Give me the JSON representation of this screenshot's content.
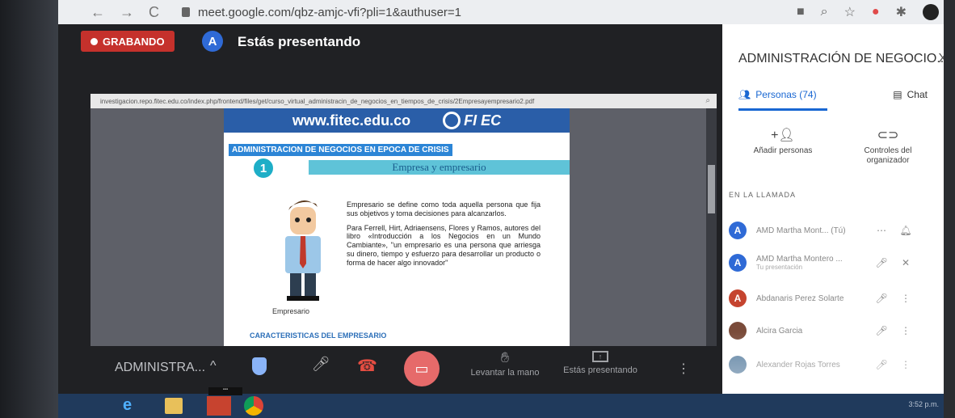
{
  "browser": {
    "url": "meet.google.com/qbz-amjc-vfi?pli=1&authuser=1",
    "nav_back": "←",
    "nav_forward": "→",
    "nav_reload": "C"
  },
  "meet": {
    "recording_label": "GRABANDO",
    "presenter_avatar": "A",
    "presenting_text": "Estás presentando"
  },
  "pdf": {
    "url": "investigacion.repo.fitec.edu.co/index.php/frontend/files/get/curso_virtual_administracin_de_negocios_en_tiempos_de_crisis/2Empresayempresario2.pdf",
    "site": "www.fitec.edu.co",
    "logo": "FI EC",
    "title": "ADMINISTRACION DE NEGOCIOS EN EPOCA DE CRISIS",
    "number": "1",
    "subtitle": "Empresa y empresario",
    "para1": "Empresario se define como toda aquella persona que fija sus objetivos y toma decisiones para alcanzarlos.",
    "para2": "Para Ferrell, Hirt, Adriaensens, Flores y Ramos, autores del libro «Introducción a los Negocios en un Mundo Cambiante», \"un empresario es una persona que arriesga su dinero, tiempo y esfuerzo para desarrollar un producto o forma de hacer algo innovador\"",
    "figure_label": "Empresario",
    "section": "CARACTERISTICAS DEL EMPRESARIO"
  },
  "controls": {
    "meeting_name": "ADMINISTRA...",
    "raise_hand": "Levantar la mano",
    "presenting": "Estás presentando"
  },
  "panel": {
    "title": "ADMINISTRACIÓN DE NEGOCIO...",
    "close": "X",
    "tab_people": "Personas (74)",
    "tab_chat": "Chat",
    "add_people": "Añadir personas",
    "host_controls": "Controles del organizador",
    "section_label": "EN LA LLAMADA",
    "participants": [
      {
        "avatar": "A",
        "name": "AMD Martha Mont... (Tú)",
        "sub": "",
        "color": "#2f6ad6"
      },
      {
        "avatar": "A",
        "name": "AMD Martha Montero ...",
        "sub": "Tu presentación",
        "color": "#2f6ad6"
      },
      {
        "avatar": "A",
        "name": "Abdanaris Perez Solarte",
        "sub": "",
        "color": "#c5442f"
      },
      {
        "avatar": "",
        "name": "Alcira Garcia",
        "sub": "",
        "color": "#7a4b3a"
      },
      {
        "avatar": "",
        "name": "Alexander Rojas Torres",
        "sub": "",
        "color": "#5a7fa0"
      }
    ]
  },
  "taskbar": {
    "clock": "3:52 p.m."
  }
}
